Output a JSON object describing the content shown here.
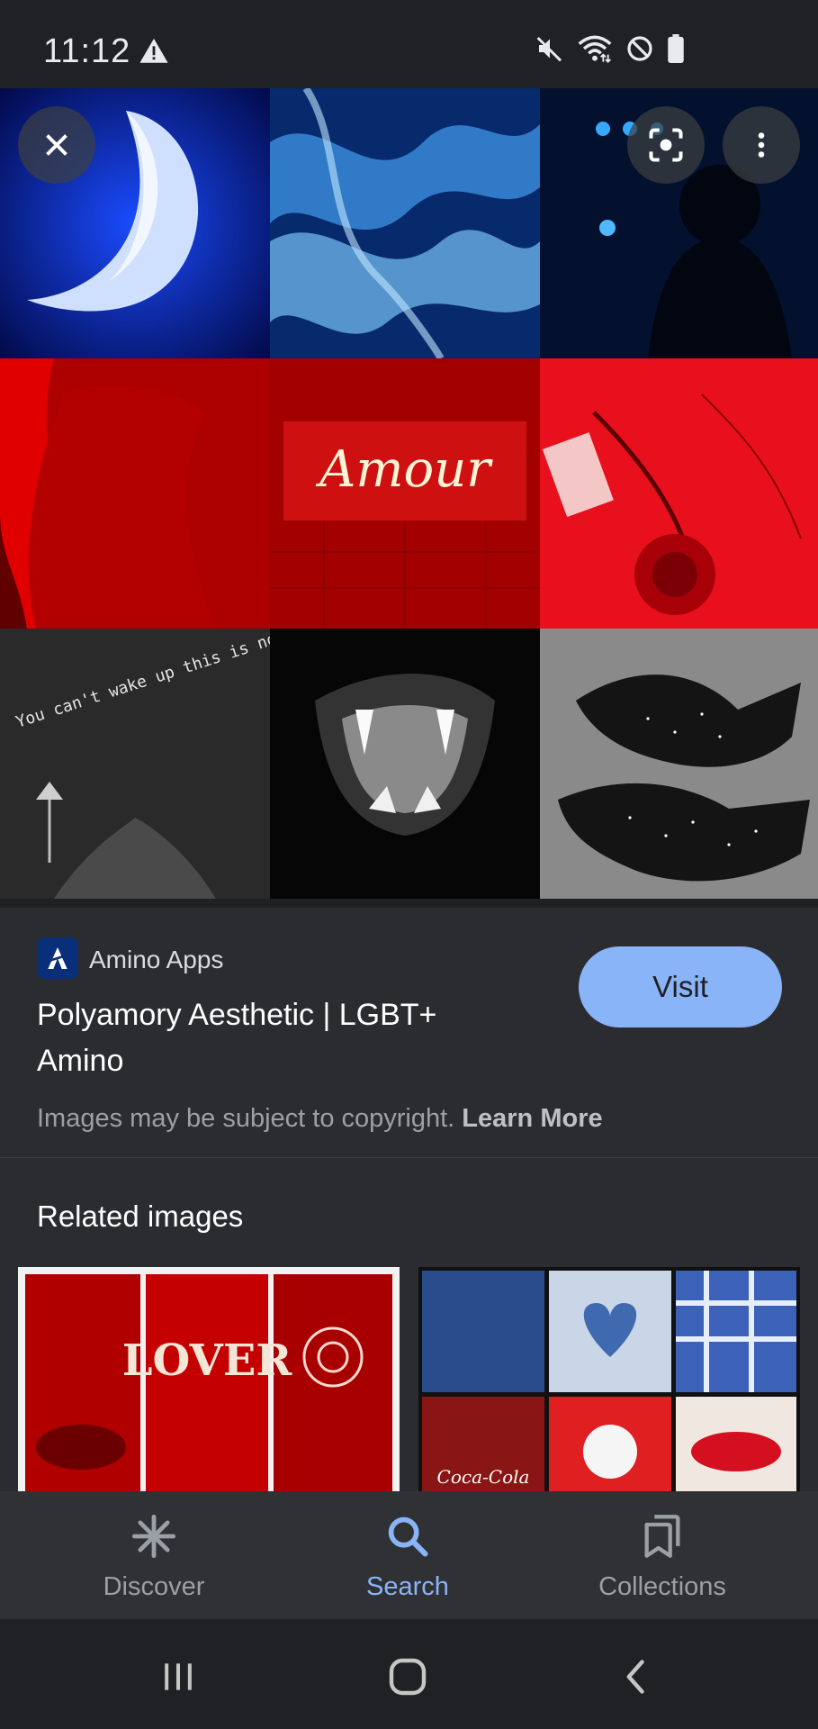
{
  "status_bar": {
    "time": "11:12",
    "icons": [
      "warning-icon",
      "mute-icon",
      "wifi-icon",
      "do-not-disturb-icon",
      "battery-icon"
    ]
  },
  "viewer": {
    "close_icon": "close-icon",
    "lens_icon": "google-lens-icon",
    "more_icon": "more-vert-icon",
    "collage_tiles": [
      {
        "text": ""
      },
      {
        "text": ""
      },
      {
        "text": ""
      },
      {
        "text": ""
      },
      {
        "text": "Amour"
      },
      {
        "text": ""
      },
      {
        "text": "You can't wake up this is not a dream"
      },
      {
        "text": ""
      },
      {
        "text": ""
      }
    ]
  },
  "result": {
    "source_name": "Amino Apps",
    "title": "Polyamory Aesthetic | LGBT+ Amino",
    "visit_label": "Visit",
    "copyright_text": "Images may be subject to copyright.",
    "learn_more": "Learn More"
  },
  "related": {
    "heading": "Related images",
    "images": [
      {
        "text": "LOVER"
      },
      {
        "text": "Coca-Cola"
      }
    ]
  },
  "bottom_nav": {
    "items": [
      {
        "label": "Discover",
        "icon": "asterisk-icon",
        "active": false
      },
      {
        "label": "Search",
        "icon": "search-icon",
        "active": true
      },
      {
        "label": "Collections",
        "icon": "collections-icon",
        "active": false
      }
    ]
  },
  "system_nav": {
    "recents": "recents-icon",
    "home": "home-icon",
    "back": "back-icon"
  },
  "colors": {
    "accent": "#8ab4f8",
    "background": "#202124",
    "surface": "#2b2c30",
    "nav": "#303134"
  }
}
